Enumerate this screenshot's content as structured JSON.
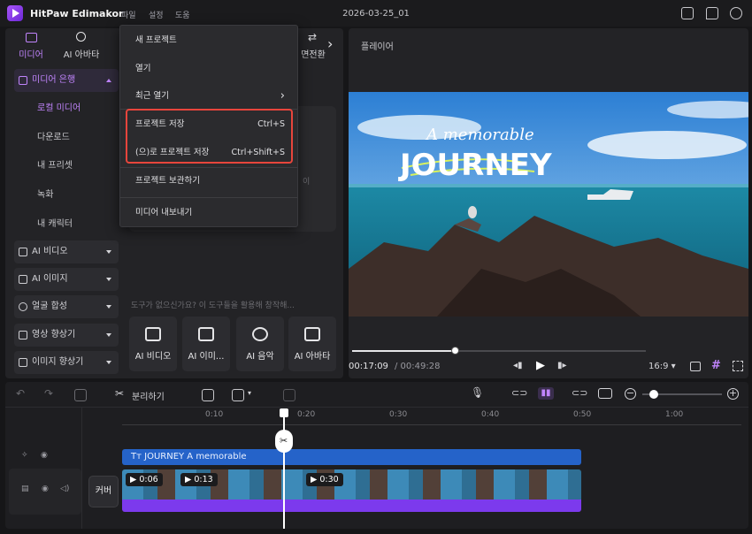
{
  "app": {
    "name": "HitPaw Edimakor",
    "menus": [
      "파일",
      "설정",
      "도움"
    ],
    "doc_title": "2026-03-25_01"
  },
  "top_tabs": {
    "media": "미디어",
    "ai_avatar": "AI 아바타",
    "transition": "면전환"
  },
  "sidebar": {
    "items": [
      {
        "label": "미디어 은행",
        "kind": "cat",
        "state": "expanded"
      },
      {
        "label": "로컬 미디어",
        "kind": "sub"
      },
      {
        "label": "다운로드",
        "kind": "sub"
      },
      {
        "label": "내 프리셋",
        "kind": "sub"
      },
      {
        "label": "녹화",
        "kind": "sub"
      },
      {
        "label": "내 캐릭터",
        "kind": "sub"
      },
      {
        "label": "AI 비디오",
        "kind": "cat"
      },
      {
        "label": "AI  이미지",
        "kind": "cat"
      },
      {
        "label": "얼굴 합성",
        "kind": "cat"
      },
      {
        "label": "영상 향상기",
        "kind": "cat"
      },
      {
        "label": "이미지 향상기",
        "kind": "cat"
      }
    ]
  },
  "content": {
    "hint": "도구가 없으신가요? 이 도구들을 활용해 창작해...",
    "partial_text": "이",
    "tools": [
      "AI 비디오",
      "AI  이미...",
      "AI 음악",
      "AI 아바타"
    ]
  },
  "file_menu": {
    "items": [
      {
        "label": "새 프로젝트",
        "shortcut": ""
      },
      {
        "label": "열기",
        "shortcut": ""
      },
      {
        "label": "최근 열기",
        "shortcut": "",
        "submenu": true
      },
      {
        "label": "프로젝트 저장",
        "shortcut": "Ctrl+S",
        "highlighted": true
      },
      {
        "label": "(으)로 프로젝트 저장",
        "shortcut": "Ctrl+Shift+S",
        "highlighted": true
      },
      {
        "label": "프로젝트 보관하기",
        "shortcut": ""
      },
      {
        "label": "미디어 내보내기",
        "shortcut": ""
      }
    ]
  },
  "player": {
    "title": "플레이어",
    "overlay_script": "A memorable",
    "overlay_title": "JOURNEY",
    "current_time": "00:17:09",
    "total_time": "/ 00:49:28",
    "progress": 0.35,
    "aspect": "16:9"
  },
  "timeline": {
    "split_label": "분리하기",
    "ruler": [
      "0:10",
      "0:20",
      "0:30",
      "0:40",
      "0:50",
      "1:00"
    ],
    "text_clip": "JOURNEY  A memorable",
    "cover_label": "커버",
    "video_badges": [
      "0:06",
      "0:13",
      "0:30"
    ],
    "playhead_fraction": 0.35
  },
  "colors": {
    "accent": "#c084fc",
    "highlight": "#e8453c",
    "text_clip": "#2563c9",
    "audio": "#7c3aed"
  }
}
